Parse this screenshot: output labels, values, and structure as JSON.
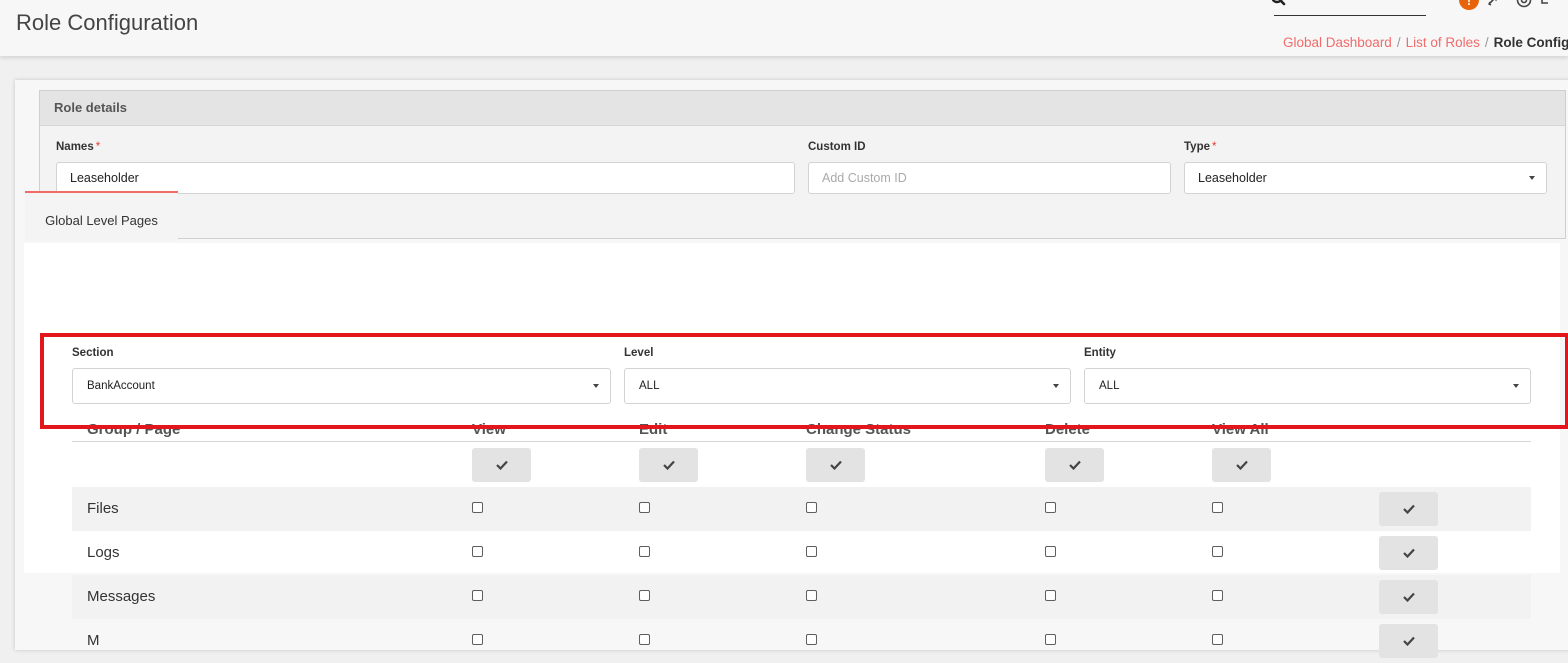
{
  "header": {
    "title": "Role Configuration",
    "alert_badge": "!",
    "breadcrumb": {
      "items": [
        "Global Dashboard",
        "List of Roles"
      ],
      "separator": "/",
      "current": "Role Configuration"
    }
  },
  "role_details": {
    "title": "Role details",
    "names": {
      "label": "Names",
      "required_mark": "*",
      "value": "Leaseholder"
    },
    "custom_id": {
      "label": "Custom ID",
      "placeholder": "Add Custom ID"
    },
    "type": {
      "label": "Type",
      "required_mark": "*",
      "value": "Leaseholder"
    }
  },
  "tabs": [
    {
      "label": "Global Level Pages"
    }
  ],
  "filters": {
    "section": {
      "label": "Section",
      "value": "BankAccount"
    },
    "level": {
      "label": "Level",
      "value": "ALL"
    },
    "entity": {
      "label": "Entity",
      "value": "ALL"
    }
  },
  "table": {
    "headers": [
      "Group / Page",
      "View",
      "Edit",
      "Change Status",
      "Delete",
      "View All"
    ],
    "rows": [
      {
        "label": "Files"
      },
      {
        "label": "Logs"
      },
      {
        "label": "Messages"
      },
      {
        "label": "M"
      }
    ]
  },
  "colors": {
    "accent": "#f26b6b",
    "highlight_border": "#e3161e",
    "alert_badge": "#e8640c"
  },
  "icons": [
    "search-icon",
    "alert-icon",
    "rocket-icon",
    "help-icon",
    "exit-icon",
    "chevron-down-icon",
    "check-icon"
  ]
}
